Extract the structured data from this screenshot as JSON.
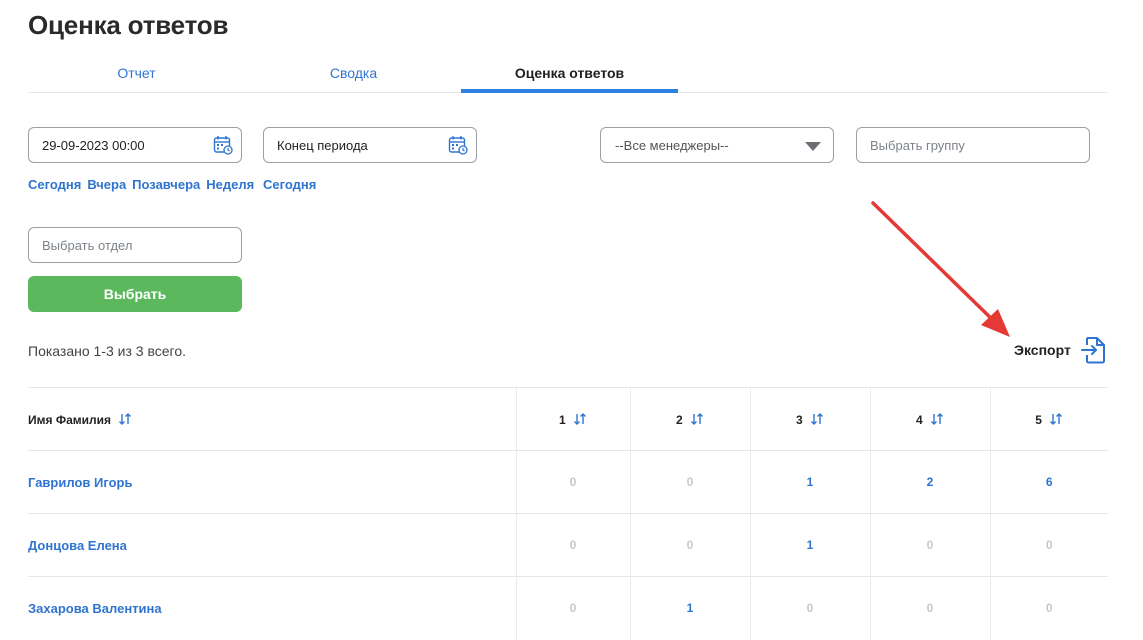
{
  "page": {
    "title": "Оценка ответов"
  },
  "tabs": [
    {
      "label": "Отчет",
      "active": false
    },
    {
      "label": "Сводка",
      "active": false
    },
    {
      "label": "Оценка ответов",
      "active": true
    }
  ],
  "filters": {
    "start_date": {
      "value": "29-09-2023 00:00",
      "icon": "calendar-clock-icon"
    },
    "end_date": {
      "placeholder": "Конец периода",
      "icon": "calendar-clock-icon"
    },
    "start_quick_links": [
      "Сегодня",
      "Вчера",
      "Позавчера",
      "Неделя"
    ],
    "end_quick_links": [
      "Сегодня"
    ],
    "manager_select": {
      "selected": "--Все менеджеры--"
    },
    "group_input": {
      "placeholder": "Выбрать группу"
    },
    "department_input": {
      "placeholder": "Выбрать отдел"
    },
    "apply_label": "Выбрать",
    "apply_color": "#5cb85c"
  },
  "summary": {
    "text": "Показано 1-3 из 3 всего."
  },
  "export": {
    "label": "Экспорт",
    "icon": "file-export-icon"
  },
  "annotation": {
    "arrow_color": "#e53935"
  },
  "table": {
    "headers": {
      "name": "Имя Фамилия",
      "scores": [
        "1",
        "2",
        "3",
        "4",
        "5"
      ]
    },
    "rows": [
      {
        "name": "Гаврилов Игорь",
        "scores": [
          "0",
          "0",
          "1",
          "2",
          "6"
        ]
      },
      {
        "name": "Донцова Елена",
        "scores": [
          "0",
          "0",
          "1",
          "0",
          "0"
        ]
      },
      {
        "name": "Захарова Валентина",
        "scores": [
          "0",
          "1",
          "0",
          "0",
          "0"
        ]
      }
    ]
  },
  "colors": {
    "accent": "#2f74d0",
    "zero_value": "#c6c9cc",
    "tab_indicator": "#2f7fe0"
  }
}
